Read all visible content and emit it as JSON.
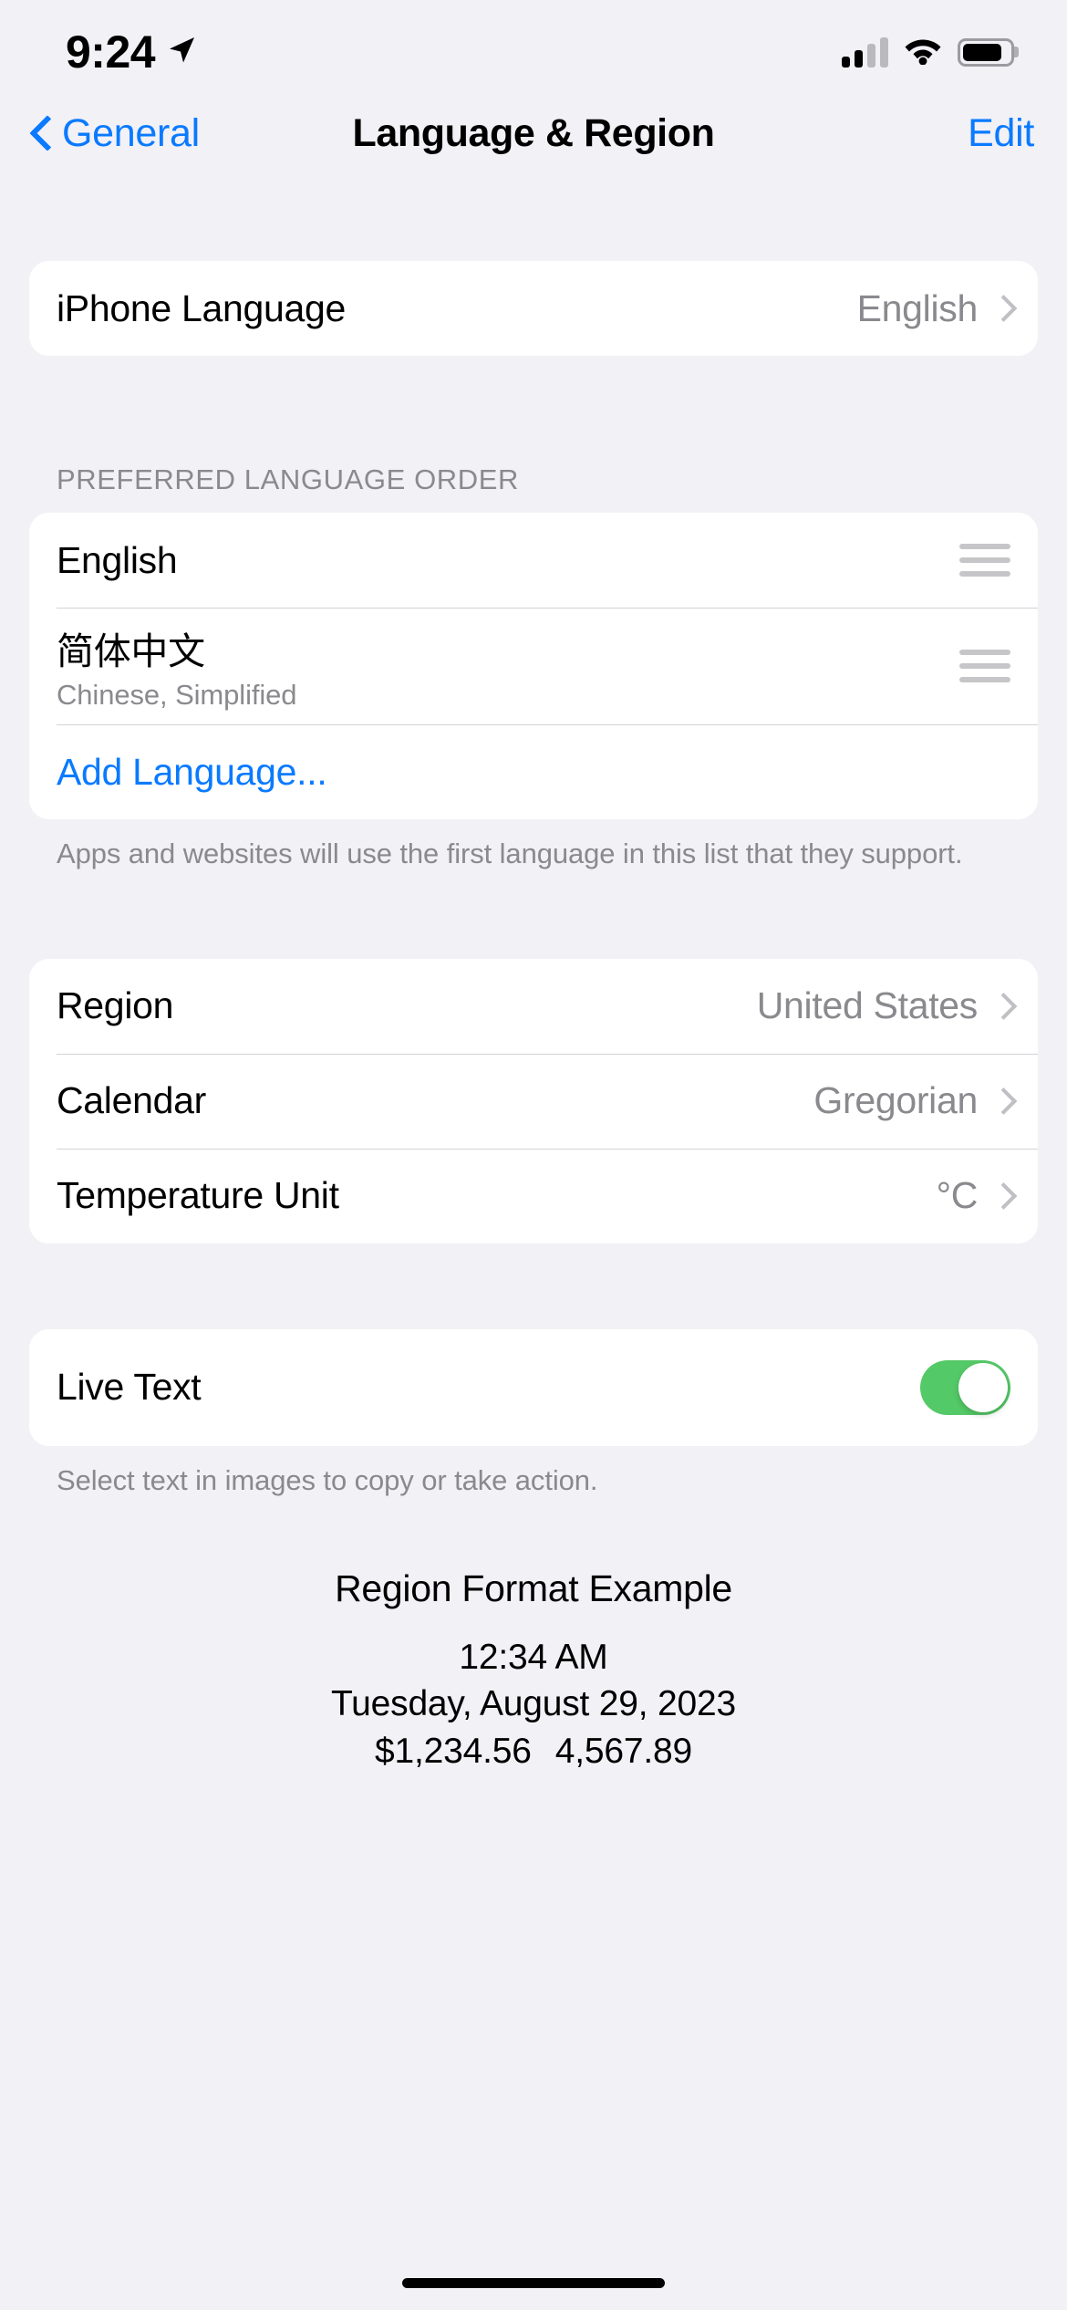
{
  "status_bar": {
    "time": "9:24",
    "location_icon": "location-arrow-icon",
    "cellular_icon": "cellular-signal-icon",
    "wifi_icon": "wifi-icon",
    "battery_icon": "battery-icon"
  },
  "nav": {
    "back_label": "General",
    "back_icon": "chevron-left-icon",
    "title": "Language & Region",
    "edit_label": "Edit"
  },
  "language_group": {
    "iphone_language_label": "iPhone Language",
    "iphone_language_value": "English"
  },
  "preferred_order": {
    "header": "PREFERRED LANGUAGE ORDER",
    "items": [
      {
        "title": "English",
        "subtitle": "",
        "handle_icon": "drag-handle-icon"
      },
      {
        "title": "简体中文",
        "subtitle": "Chinese, Simplified",
        "handle_icon": "drag-handle-icon"
      }
    ],
    "add_language_label": "Add Language...",
    "footer": "Apps and websites will use the first language in this list that they support."
  },
  "region_group": {
    "rows": [
      {
        "label": "Region",
        "value": "United States"
      },
      {
        "label": "Calendar",
        "value": "Gregorian"
      },
      {
        "label": "Temperature Unit",
        "value": "°C"
      }
    ]
  },
  "live_text": {
    "label": "Live Text",
    "enabled": true,
    "footer": "Select text in images to copy or take action."
  },
  "region_example": {
    "title": "Region Format Example",
    "time": "12:34 AM",
    "date": "Tuesday, August 29, 2023",
    "currency": "$1,234.56",
    "number": "4,567.89"
  },
  "colors": {
    "accent_blue": "#0A7AFF",
    "toggle_green": "#54C967",
    "background": "#F2F1F6",
    "card": "#FFFFFF",
    "secondary_text": "#8A8A8E"
  }
}
